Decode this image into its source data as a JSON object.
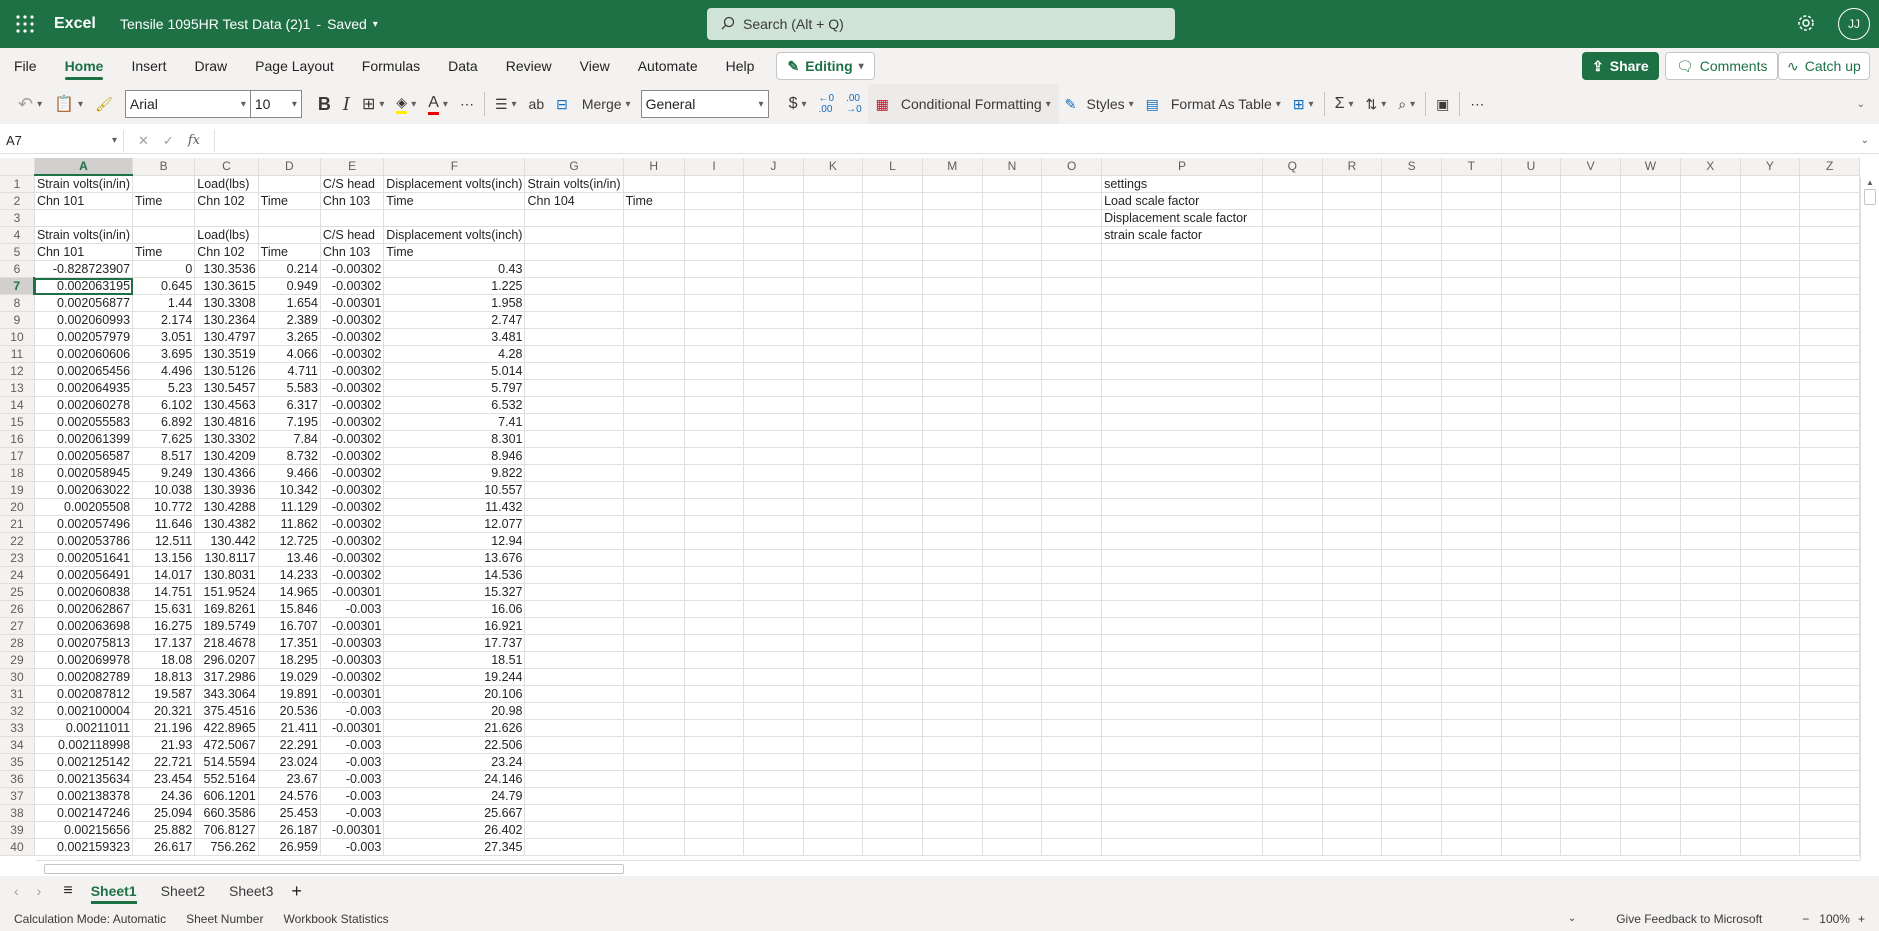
{
  "titlebar": {
    "app_name": "Excel",
    "doc_title": "Tensile 1095HR Test Data (2)1",
    "save_status": "Saved",
    "search_placeholder": "Search (Alt + Q)",
    "user_initials": "JJ"
  },
  "menu": {
    "items": [
      "File",
      "Home",
      "Insert",
      "Draw",
      "Page Layout",
      "Formulas",
      "Data",
      "Review",
      "View",
      "Automate",
      "Help"
    ],
    "active": "Home",
    "editing_label": "Editing",
    "share_label": "Share",
    "comments_label": "Comments",
    "catchup_label": "Catch up"
  },
  "toolbar": {
    "font_name": "Arial",
    "font_size": "10",
    "merge_label": "Merge",
    "number_format": "General",
    "conditional_formatting_label": "Conditional Formatting",
    "styles_label": "Styles",
    "format_as_table_label": "Format As Table"
  },
  "formula_bar": {
    "name_box": "A7",
    "fx_label": "fx",
    "formula": ""
  },
  "grid": {
    "columns": [
      "A",
      "B",
      "C",
      "D",
      "E",
      "F",
      "G",
      "H",
      "I",
      "J",
      "K",
      "L",
      "M",
      "N",
      "O",
      "P",
      "Q",
      "R",
      "S",
      "T",
      "U",
      "V",
      "W",
      "X",
      "Y",
      "Z"
    ],
    "selected_column": "A",
    "selected_row": 7,
    "rows": [
      {
        "n": 1,
        "cells": [
          "Strain volts(in/in)",
          "",
          "Load(lbs)",
          "",
          "C/S head",
          "Displacement volts(inch)",
          "Strain volts(in/in)"
        ]
      },
      {
        "n": 2,
        "cells": [
          "Chn 101",
          "Time",
          "Chn 102",
          "Time",
          "Chn 103",
          "Time",
          "Chn 104",
          "Time"
        ]
      },
      {
        "n": 3,
        "cells": []
      },
      {
        "n": 4,
        "cells": [
          "Strain volts(in/in)",
          "",
          "Load(lbs)",
          "",
          "C/S head",
          "Displacement volts(inch)"
        ]
      },
      {
        "n": 5,
        "cells": [
          "Chn 101",
          "Time",
          "Chn 102",
          "Time",
          "Chn 103",
          "Time"
        ]
      },
      {
        "n": 6,
        "cells": [
          "-0.828723907",
          "0",
          "130.3536",
          "0.214",
          "-0.00302",
          "0.43"
        ]
      },
      {
        "n": 7,
        "cells": [
          "0.002063195",
          "0.645",
          "130.3615",
          "0.949",
          "-0.00302",
          "1.225"
        ]
      },
      {
        "n": 8,
        "cells": [
          "0.002056877",
          "1.44",
          "130.3308",
          "1.654",
          "-0.00301",
          "1.958"
        ]
      },
      {
        "n": 9,
        "cells": [
          "0.002060993",
          "2.174",
          "130.2364",
          "2.389",
          "-0.00302",
          "2.747"
        ]
      },
      {
        "n": 10,
        "cells": [
          "0.002057979",
          "3.051",
          "130.4797",
          "3.265",
          "-0.00302",
          "3.481"
        ]
      },
      {
        "n": 11,
        "cells": [
          "0.002060606",
          "3.695",
          "130.3519",
          "4.066",
          "-0.00302",
          "4.28"
        ]
      },
      {
        "n": 12,
        "cells": [
          "0.002065456",
          "4.496",
          "130.5126",
          "4.711",
          "-0.00302",
          "5.014"
        ]
      },
      {
        "n": 13,
        "cells": [
          "0.002064935",
          "5.23",
          "130.5457",
          "5.583",
          "-0.00302",
          "5.797"
        ]
      },
      {
        "n": 14,
        "cells": [
          "0.002060278",
          "6.102",
          "130.4563",
          "6.317",
          "-0.00302",
          "6.532"
        ]
      },
      {
        "n": 15,
        "cells": [
          "0.002055583",
          "6.892",
          "130.4816",
          "7.195",
          "-0.00302",
          "7.41"
        ]
      },
      {
        "n": 16,
        "cells": [
          "0.002061399",
          "7.625",
          "130.3302",
          "7.84",
          "-0.00302",
          "8.301"
        ]
      },
      {
        "n": 17,
        "cells": [
          "0.002056587",
          "8.517",
          "130.4209",
          "8.732",
          "-0.00302",
          "8.946"
        ]
      },
      {
        "n": 18,
        "cells": [
          "0.002058945",
          "9.249",
          "130.4366",
          "9.466",
          "-0.00302",
          "9.822"
        ]
      },
      {
        "n": 19,
        "cells": [
          "0.002063022",
          "10.038",
          "130.3936",
          "10.342",
          "-0.00302",
          "10.557"
        ]
      },
      {
        "n": 20,
        "cells": [
          "0.00205508",
          "10.772",
          "130.4288",
          "11.129",
          "-0.00302",
          "11.432"
        ]
      },
      {
        "n": 21,
        "cells": [
          "0.002057496",
          "11.646",
          "130.4382",
          "11.862",
          "-0.00302",
          "12.077"
        ]
      },
      {
        "n": 22,
        "cells": [
          "0.002053786",
          "12.511",
          "130.442",
          "12.725",
          "-0.00302",
          "12.94"
        ]
      },
      {
        "n": 23,
        "cells": [
          "0.002051641",
          "13.156",
          "130.8117",
          "13.46",
          "-0.00302",
          "13.676"
        ]
      },
      {
        "n": 24,
        "cells": [
          "0.002056491",
          "14.017",
          "130.8031",
          "14.233",
          "-0.00302",
          "14.536"
        ]
      },
      {
        "n": 25,
        "cells": [
          "0.002060838",
          "14.751",
          "151.9524",
          "14.965",
          "-0.00301",
          "15.327"
        ]
      },
      {
        "n": 26,
        "cells": [
          "0.002062867",
          "15.631",
          "169.8261",
          "15.846",
          "-0.003",
          "16.06"
        ]
      },
      {
        "n": 27,
        "cells": [
          "0.002063698",
          "16.275",
          "189.5749",
          "16.707",
          "-0.00301",
          "16.921"
        ]
      },
      {
        "n": 28,
        "cells": [
          "0.002075813",
          "17.137",
          "218.4678",
          "17.351",
          "-0.00303",
          "17.737"
        ]
      },
      {
        "n": 29,
        "cells": [
          "0.002069978",
          "18.08",
          "296.0207",
          "18.295",
          "-0.00303",
          "18.51"
        ]
      },
      {
        "n": 30,
        "cells": [
          "0.002082789",
          "18.813",
          "317.2986",
          "19.029",
          "-0.00302",
          "19.244"
        ]
      },
      {
        "n": 31,
        "cells": [
          "0.002087812",
          "19.587",
          "343.3064",
          "19.891",
          "-0.00301",
          "20.106"
        ]
      },
      {
        "n": 32,
        "cells": [
          "0.002100004",
          "20.321",
          "375.4516",
          "20.536",
          "-0.003",
          "20.98"
        ]
      },
      {
        "n": 33,
        "cells": [
          "0.00211011",
          "21.196",
          "422.8965",
          "21.411",
          "-0.00301",
          "21.626"
        ]
      },
      {
        "n": 34,
        "cells": [
          "0.002118998",
          "21.93",
          "472.5067",
          "22.291",
          "-0.003",
          "22.506"
        ]
      },
      {
        "n": 35,
        "cells": [
          "0.002125142",
          "22.721",
          "514.5594",
          "23.024",
          "-0.003",
          "23.24"
        ]
      },
      {
        "n": 36,
        "cells": [
          "0.002135634",
          "23.454",
          "552.5164",
          "23.67",
          "-0.003",
          "24.146"
        ]
      },
      {
        "n": 37,
        "cells": [
          "0.002138378",
          "24.36",
          "606.1201",
          "24.576",
          "-0.003",
          "24.79"
        ]
      },
      {
        "n": 38,
        "cells": [
          "0.002147246",
          "25.094",
          "660.3586",
          "25.453",
          "-0.003",
          "25.667"
        ]
      },
      {
        "n": 39,
        "cells": [
          "0.00215656",
          "25.882",
          "706.8127",
          "26.187",
          "-0.00301",
          "26.402"
        ]
      },
      {
        "n": 40,
        "cells": [
          "0.002159323",
          "26.617",
          "756.262",
          "26.959",
          "-0.003",
          "27.345"
        ]
      }
    ],
    "settings_cells": {
      "1": "settings",
      "2": "Load scale factor",
      "3": "Displacement scale factor",
      "4": "strain scale factor"
    }
  },
  "sheets": {
    "tabs": [
      "Sheet1",
      "Sheet2",
      "Sheet3"
    ],
    "active": "Sheet1"
  },
  "status": {
    "calc_mode": "Calculation Mode: Automatic",
    "sheet_number": "Sheet Number",
    "workbook_stats": "Workbook Statistics",
    "feedback": "Give Feedback to Microsoft",
    "zoom": "100%"
  }
}
